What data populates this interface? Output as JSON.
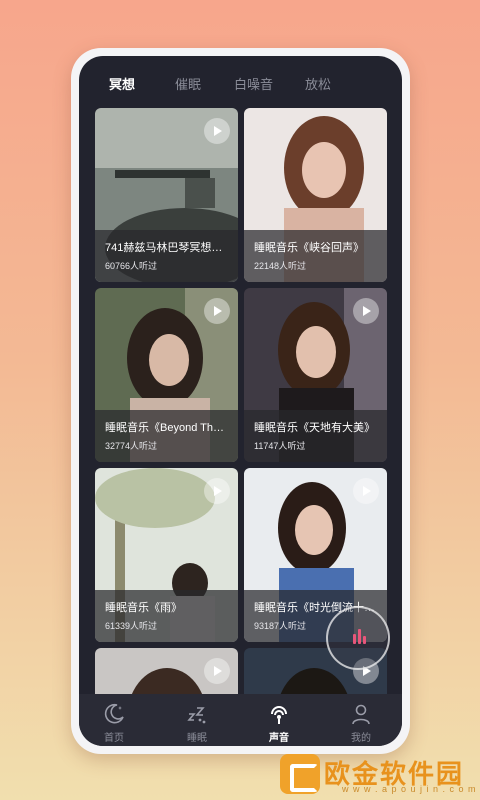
{
  "tabs": [
    {
      "label": "冥想",
      "active": true
    },
    {
      "label": "催眠",
      "active": false
    },
    {
      "label": "白噪音",
      "active": false
    },
    {
      "label": "放松",
      "active": false
    }
  ],
  "cards": [
    {
      "title": "741赫兹马林巴琴冥想…",
      "listeners": "60766人听过"
    },
    {
      "title": "睡眠音乐《峡谷回声》",
      "listeners": "22148人听过"
    },
    {
      "title": "睡眠音乐《Beyond Th…",
      "listeners": "32774人听过"
    },
    {
      "title": "睡眠音乐《天地有大美》",
      "listeners": "11747人听过"
    },
    {
      "title": "睡眠音乐《雨》",
      "listeners": "61339人听过"
    },
    {
      "title": "睡眠音乐《时光倒流十…",
      "listeners": "93187人听过"
    },
    {
      "title": "",
      "listeners": ""
    },
    {
      "title": "",
      "listeners": ""
    }
  ],
  "nav": [
    {
      "label": "首页",
      "icon": "moon-star-icon",
      "active": false
    },
    {
      "label": "睡眠",
      "icon": "sleep-zzz-icon",
      "active": false
    },
    {
      "label": "声音",
      "icon": "sound-wave-icon",
      "active": true
    },
    {
      "label": "我的",
      "icon": "user-icon",
      "active": false
    }
  ],
  "watermark": {
    "name": "欧金软件园",
    "url": "w w w . a p o u j i n . c o m"
  },
  "colors": {
    "screen_bg": "#22232e",
    "accent_pink": "#e8567a",
    "watermark_orange": "#e8921d"
  }
}
